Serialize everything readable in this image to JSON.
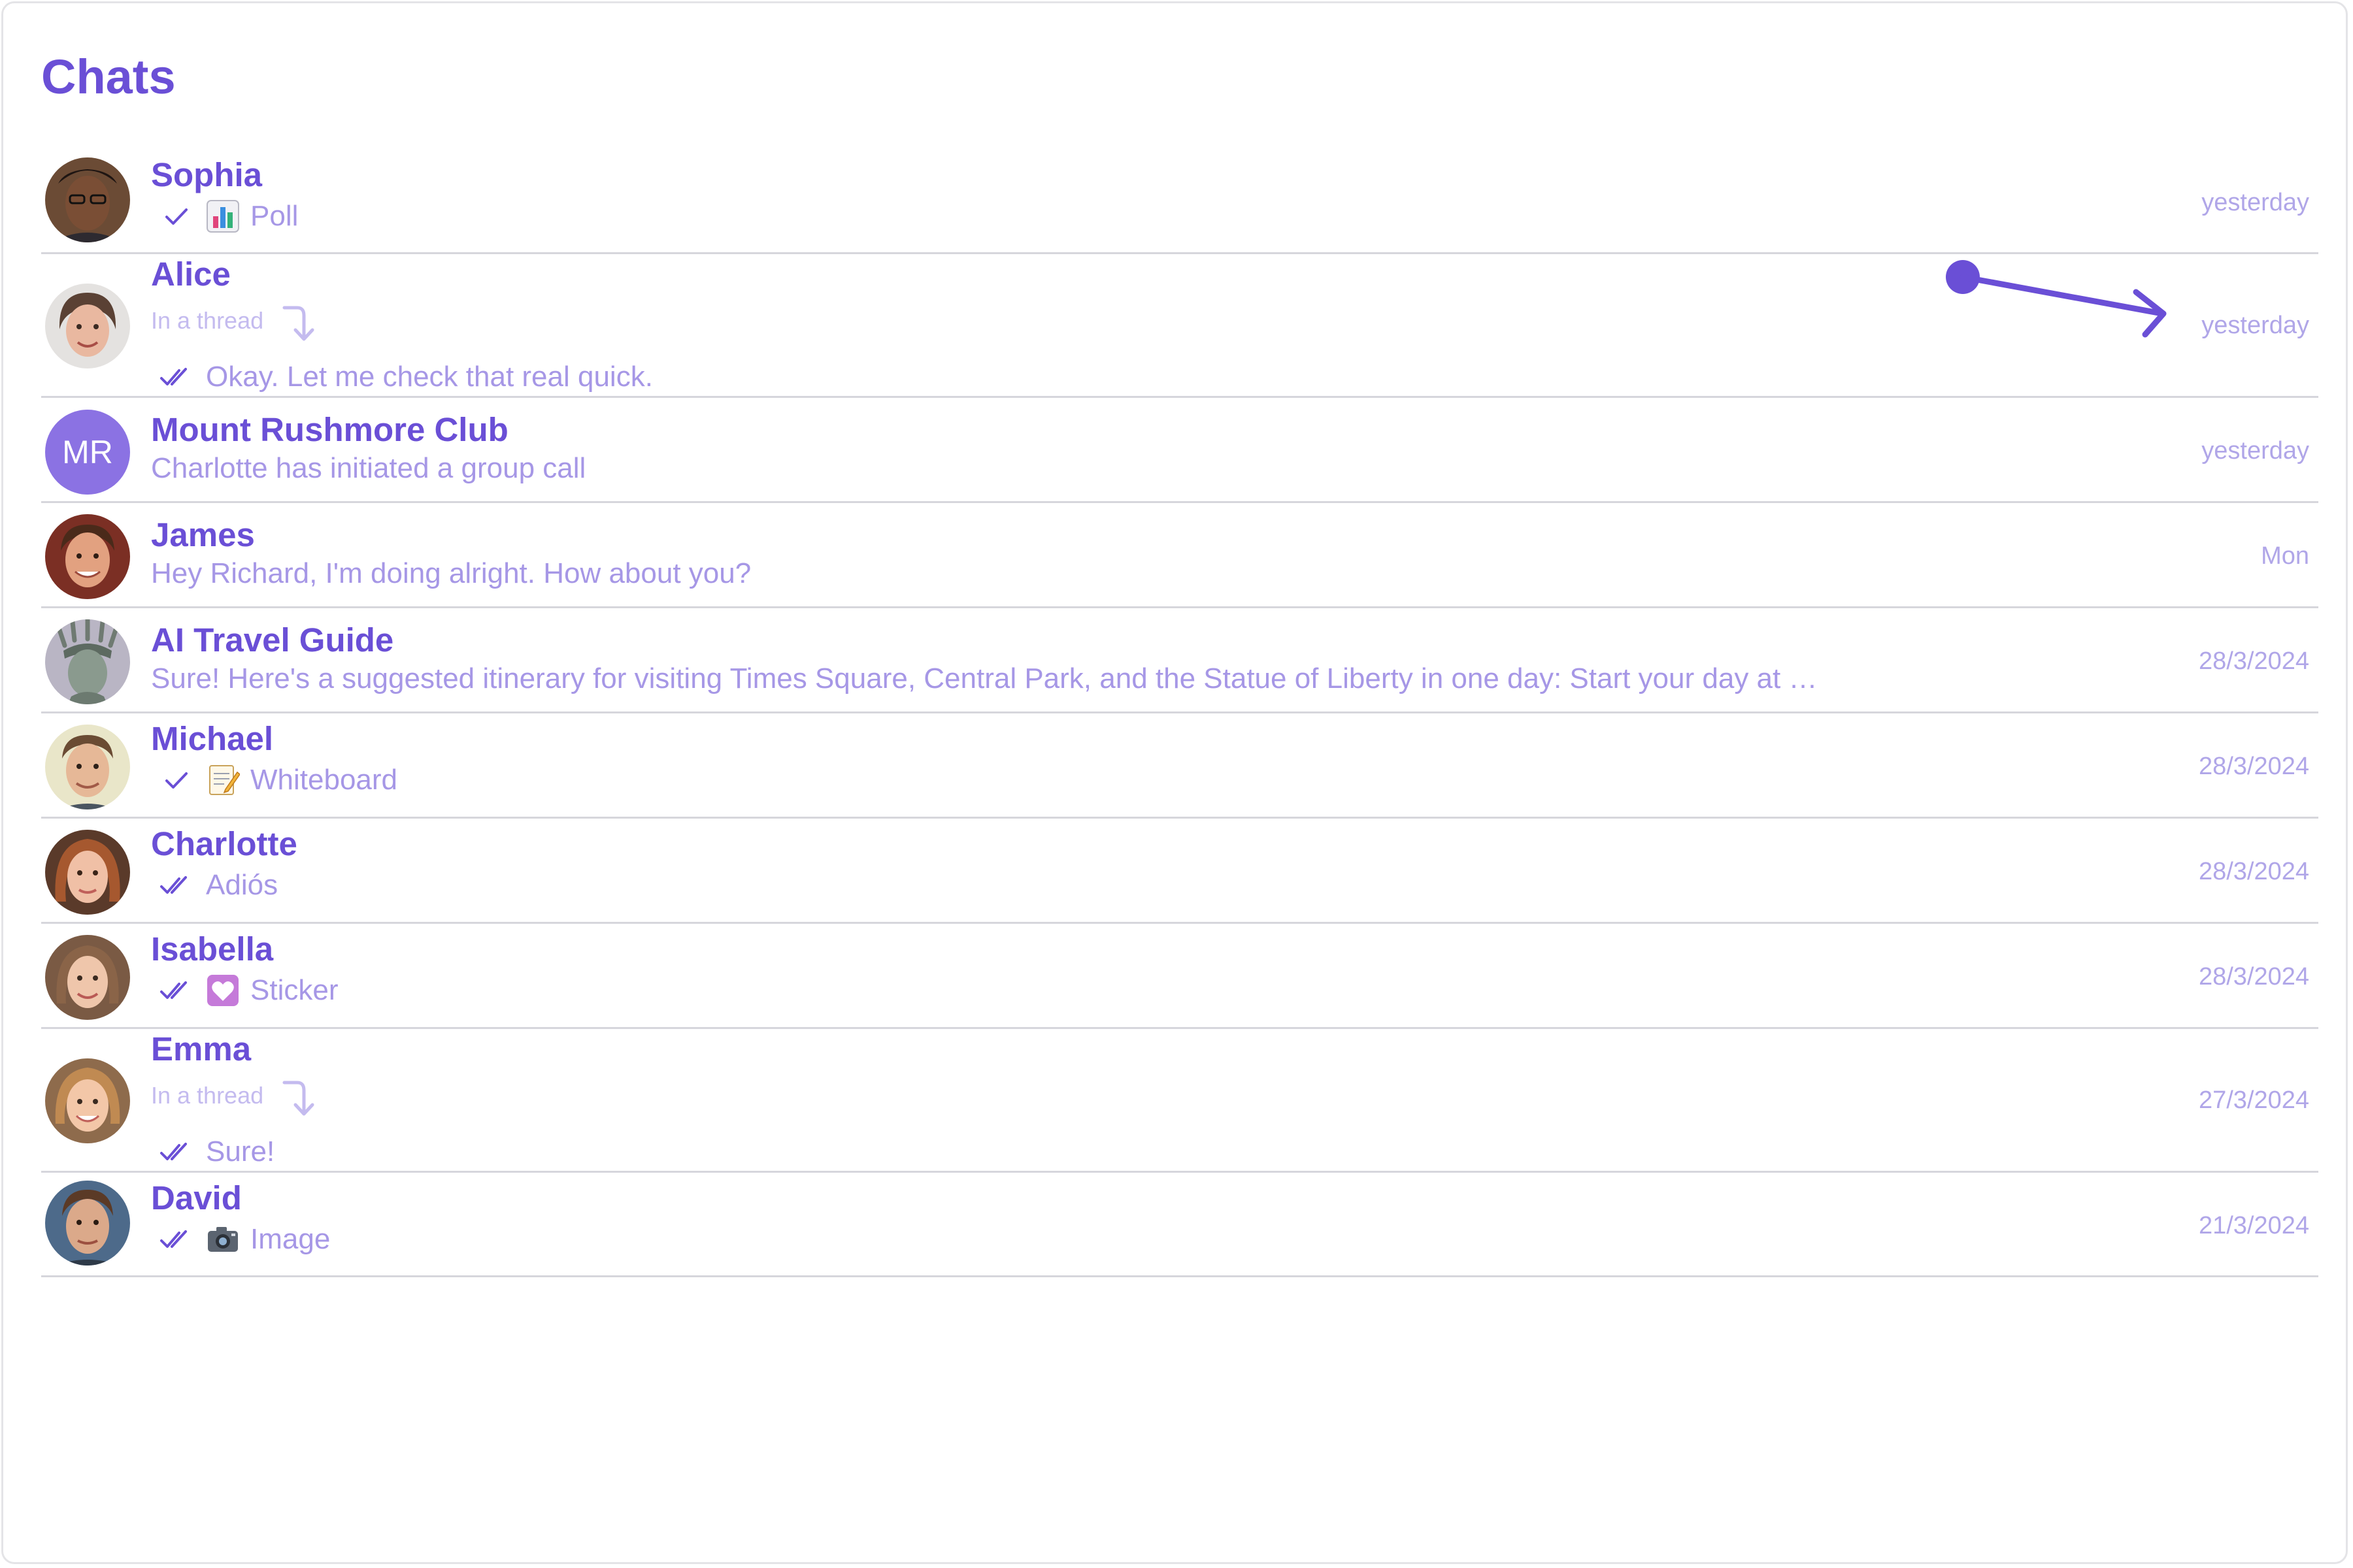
{
  "header": {
    "title": "Chats"
  },
  "colors": {
    "accent": "#6a4fd6",
    "muted": "#a697e6",
    "divider": "#d6d6dc",
    "initials_bg": "#8b72e3"
  },
  "chats": [
    {
      "name": "Sophia",
      "receipt": "single-check-icon",
      "icon": "poll-icon",
      "preview": "Poll",
      "time": "yesterday"
    },
    {
      "name": "Alice",
      "thread_label": "In a thread",
      "receipt": "double-check-icon",
      "preview": "Okay. Let me check that real quick.",
      "time": "yesterday"
    },
    {
      "name": "Mount Rushmore Club",
      "initials": "MR",
      "preview": "Charlotte has initiated a group call",
      "time": "yesterday"
    },
    {
      "name": "James",
      "preview": "Hey Richard, I'm doing alright. How about you?",
      "time": "Mon"
    },
    {
      "name": "AI Travel Guide",
      "preview": "Sure! Here's a suggested itinerary for visiting Times Square, Central Park, and the Statue of Liberty in one day: Start your day at …",
      "time": "28/3/2024"
    },
    {
      "name": "Michael",
      "receipt": "single-check-icon",
      "icon": "memo-icon",
      "preview": "Whiteboard",
      "time": "28/3/2024"
    },
    {
      "name": "Charlotte",
      "receipt": "double-check-icon",
      "preview": "Adiós",
      "time": "28/3/2024"
    },
    {
      "name": "Isabella",
      "receipt": "double-check-icon",
      "icon": "heart-sticker-icon",
      "preview": "Sticker",
      "time": "28/3/2024"
    },
    {
      "name": "Emma",
      "thread_label": "In a thread",
      "receipt": "double-check-icon",
      "preview": "Sure!",
      "time": "27/3/2024"
    },
    {
      "name": "David",
      "receipt": "double-check-icon",
      "icon": "camera-icon",
      "preview": "Image",
      "time": "21/3/2024"
    }
  ]
}
